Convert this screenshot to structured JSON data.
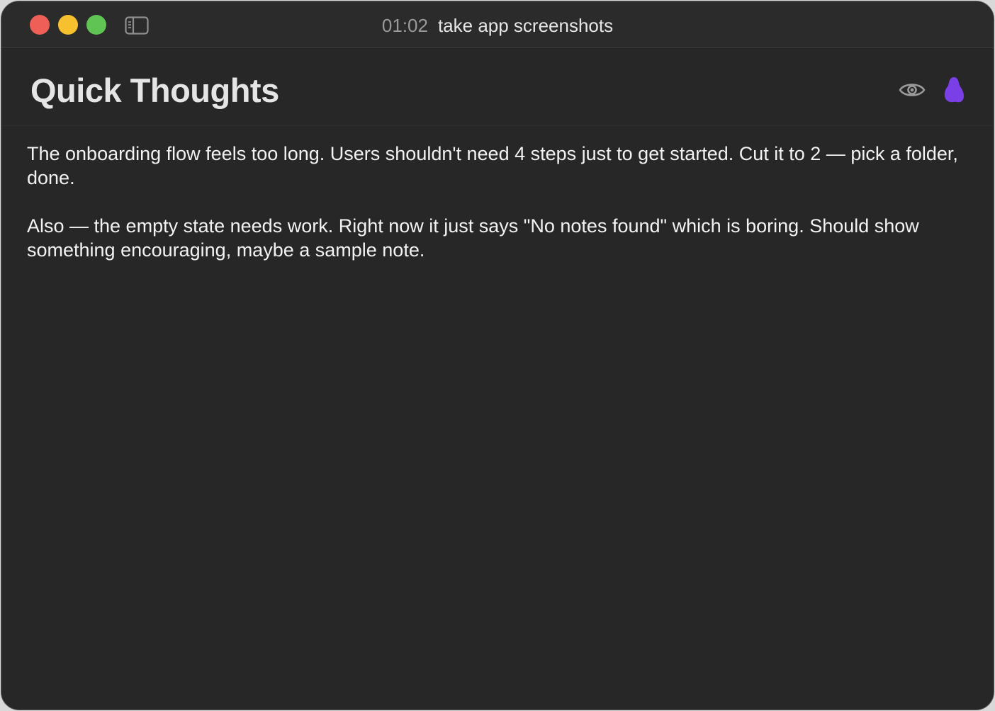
{
  "window": {
    "timer": "01:02",
    "title": "take app screenshots",
    "traffic_colors": {
      "close": "#ee5f58",
      "minimize": "#f6c02f",
      "maximize": "#5fc454"
    }
  },
  "note": {
    "title": "Quick Thoughts",
    "paragraphs": [
      "The onboarding flow feels too long. Users shouldn't need 4 steps just to get started. Cut it to 2 — pick a folder, done.",
      "Also — the empty state needs work. Right now it just says \"No notes found\" which is boring. Should show something encouraging, maybe a sample note."
    ]
  },
  "header_icons": {
    "preview": "eye-icon",
    "accent": "purple-blob-icon",
    "accent_color": "#7a3fe6"
  }
}
